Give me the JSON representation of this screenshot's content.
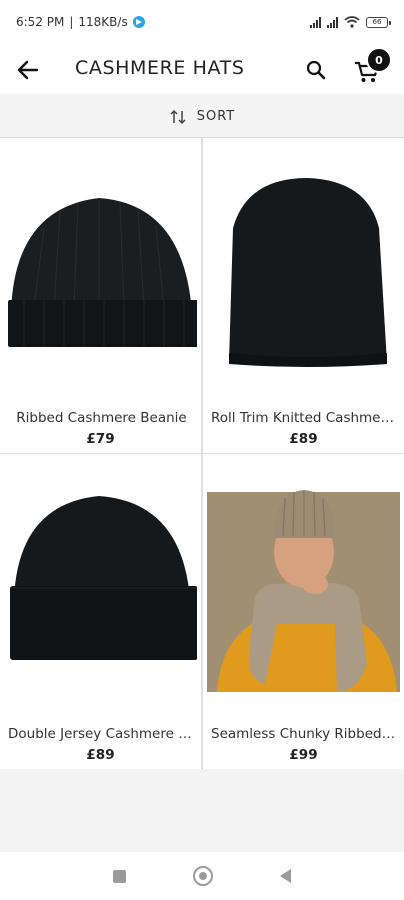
{
  "status_bar": {
    "time": "6:52 PM",
    "speed": "118KB/s",
    "battery": "66"
  },
  "header": {
    "title": "CASHMERE HATS",
    "cart_count": "0"
  },
  "sort": {
    "label": "SORT"
  },
  "products": [
    {
      "name": "Ribbed Cashmere Beanie",
      "price": "£79"
    },
    {
      "name": "Roll Trim Knitted Cashmere Beanie",
      "price": "£89"
    },
    {
      "name": "Double Jersey Cashmere Beanie",
      "price": "£89"
    },
    {
      "name": "Seamless Chunky Ribbed Beanie",
      "price": "£99"
    }
  ],
  "icons": {
    "back": "arrow-left-icon",
    "search": "search-icon",
    "cart": "cart-icon",
    "sort": "sort-arrows-icon"
  },
  "colors": {
    "hat": "#14181a",
    "sweater": "#e09a1e",
    "scarf": "#a99b86"
  }
}
